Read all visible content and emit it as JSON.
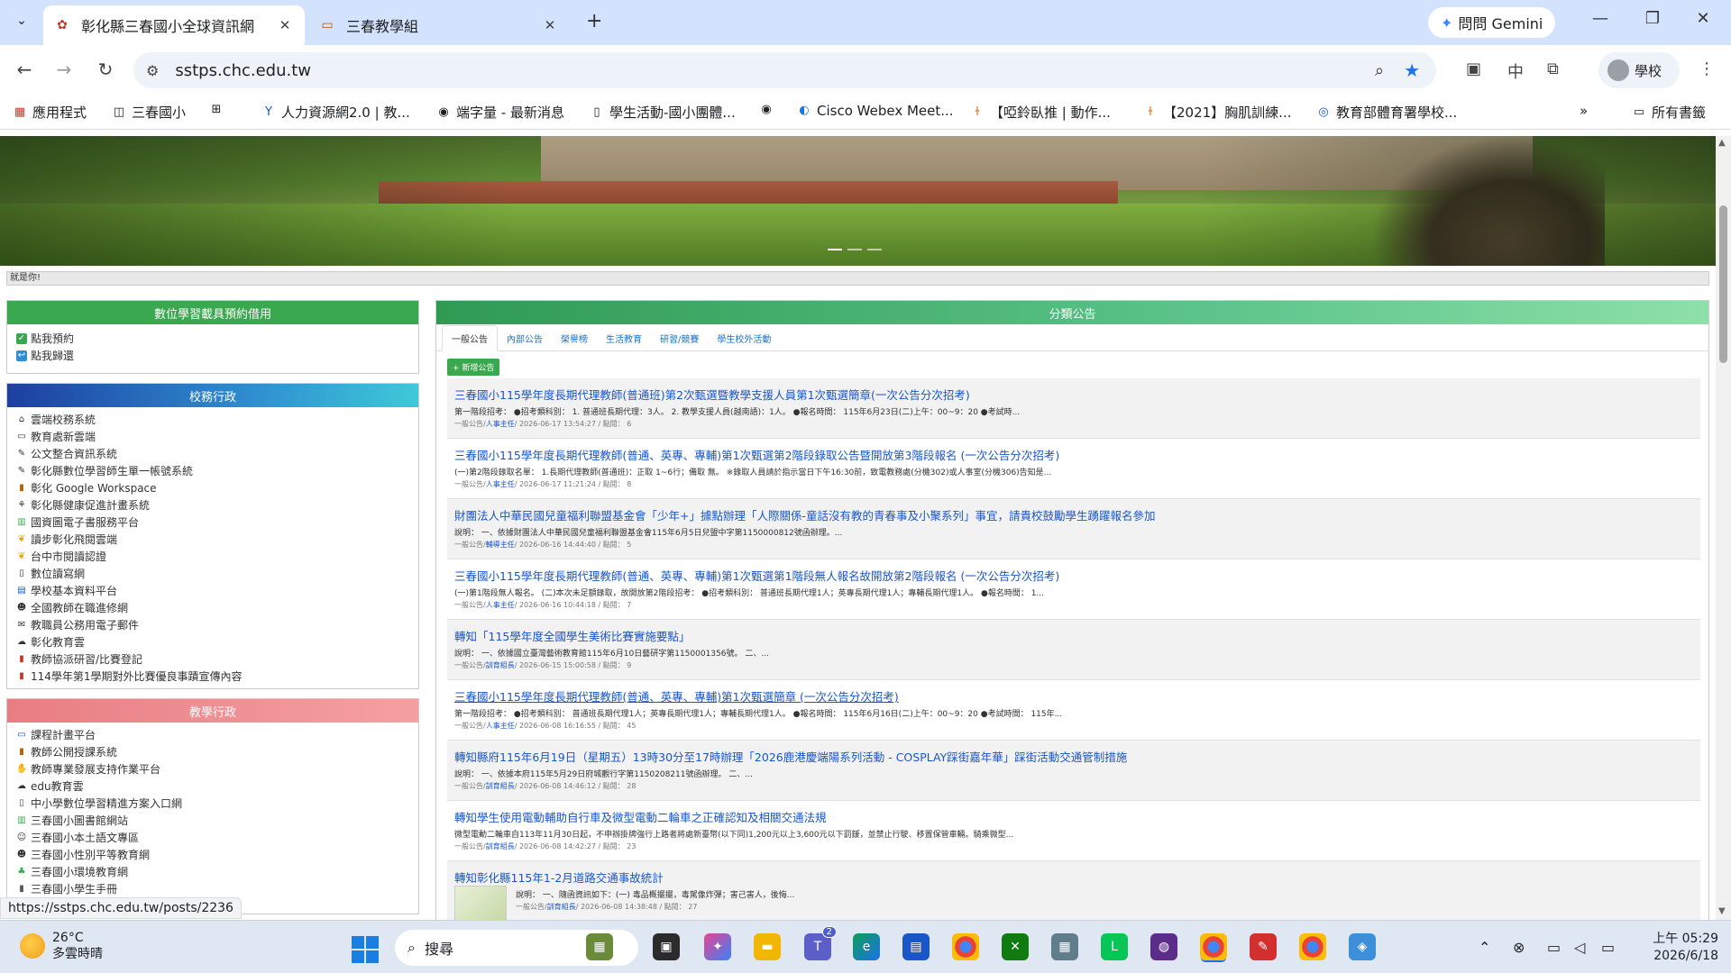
{
  "browser": {
    "tabs": [
      {
        "title": "彰化縣三春國小全球資訊網",
        "active": true
      },
      {
        "title": "三春教學組",
        "active": false
      }
    ],
    "gemini_label": "問問 Gemini",
    "url": "sstps.chc.edu.tw",
    "ime_indicator": "中",
    "profile_label": "學校",
    "bookmarks": [
      "應用程式",
      "三春國小",
      "人力資源網2.0 | 教...",
      "端字量 - 最新消息",
      "學生活動-國小團體...",
      "Cisco Webex Meet...",
      "【啞鈴臥推 | 動作...",
      "【2021】胸肌訓練...",
      "教育部體育署學校..."
    ],
    "all_bookmarks_label": "所有書籤",
    "status_url": "https://sstps.chc.edu.tw/posts/2236"
  },
  "page": {
    "marquee_text": "就是你!",
    "left_panels": [
      {
        "title": "數位學習載具預約借用",
        "items": [
          "點我預約",
          "點我歸還"
        ]
      },
      {
        "title": "校務行政",
        "items": [
          "雲端校務系統",
          "教育處新雲端",
          "公文整合資訊系統",
          "彰化縣數位學習師生單一帳號系統",
          "彰化 Google Workspace",
          "彰化縣健康促進計畫系統",
          "國資圖電子書服務平台",
          "讀步彰化飛閱雲端",
          "台中市閱讀認證",
          "數位讀寫網",
          "學校基本資料平台",
          "全國教師在職進修網",
          "教職員公務用電子郵件",
          "彰化教育雲",
          "教師協派研習/比賽登記",
          "114學年第1學期對外比賽優良事蹟宣傳內容"
        ]
      },
      {
        "title": "教學行政",
        "items": [
          "課程計畫平台",
          "教師公開授課系統",
          "教師專業發展支持作業平台",
          "edu教育雲",
          "中小學數位學習精進方案入口網",
          "三春國小圖書館網站",
          "三春國小本土語文專區",
          "三春國小性別平等教育網",
          "三春國小環境教育網",
          "三春國小學生手冊"
        ]
      }
    ],
    "announcements": {
      "title": "分類公告",
      "tabs": [
        "一般公告",
        "內部公告",
        "榮譽榜",
        "生活教育",
        "研習/競賽",
        "學生校外活動"
      ],
      "new_button": "+ 新增公告",
      "posts": [
        {
          "title": "三春國小115學年度長期代理教師(普通班)第2次甄選暨教學支援人員第1次甄選簡章(一次公告分次招考)",
          "summary": "第一階段招考： ●招考類科別： 1. 普通班長期代理：3人。 2. 教學支援人員(越南語)：1人。 ●報名時間： 115年6月23日(二)上午：00~9：20 ●考試時...",
          "meta": "一般公告/",
          "author": "人事主任",
          "info": "/ 2026-06-17 13:54:27 / 點閱： 6"
        },
        {
          "title": "三春國小115學年度長期代理教師(普通、英專、專輔)第1次甄選第2階段錄取公告暨開放第3階段報名 (一次公告分次招考)",
          "summary": "(一)第2階段錄取名單： 1.長期代理教師(普通班)：正取 1~6行；備取 無。 ※錄取人員請於指示當日下午16:30前，致電教務處(分機302)或人事室(分機306)告知是...",
          "meta": "一般公告/",
          "author": "人事主任",
          "info": "/ 2026-06-17 11:21:24 / 點閱： 8"
        },
        {
          "title": "財團法人中華民國兒童福利聯盟基金會「少年+」據點辦理「人際關係-童話沒有教的青春事及小聚系列」事宜，請貴校鼓勵學生踴躍報名參加",
          "summary": "說明： 一、依據財團法人中華民國兒童福利聯盟基金會115年6月5日兒盟中字第1150000812號函辦理。...",
          "meta": "一般公告/",
          "author": "輔導主任",
          "info": "/ 2026-06-16 14:44:40 / 點閱： 5"
        },
        {
          "title": "三春國小115學年度長期代理教師(普通、英專、專輔)第1次甄選第1階段無人報名故開放第2階段報名 (一次公告分次招考)",
          "summary": "(一)第1階段無人報名。 (二)本次未足額錄取，故開放第2階段招考： ●招考類科別： 普通班長期代理1人；英專長期代理1人；專輔長期代理1人。 ●報名時間： 1...",
          "meta": "一般公告/",
          "author": "人事主任",
          "info": "/ 2026-06-16 10:44:18 / 點閱： 7"
        },
        {
          "title": "轉知「115學年度全國學生美術比賽實施要點」",
          "summary": "說明： 一、依據國立臺灣藝術教育館115年6月10日藝研字第1150001356號。 二、...",
          "meta": "一般公告/",
          "author": "訓育組長",
          "info": "/ 2026-06-15 15:00:58 / 點閱： 9"
        },
        {
          "title": "三春國小115學年度長期代理教師(普通、英專、專輔)第1次甄選簡章 (一次公告分次招考)",
          "summary": "第一階段招考： ●招考類科別： 普通班長期代理1人；英專長期代理1人；專輔長期代理1人。 ●報名時間： 115年6月16日(二)上午：00~9：20 ●考試時間： 115年...",
          "meta": "一般公告/",
          "author": "人事主任",
          "info": "/ 2026-06-08 16:16:55 / 點閱： 45"
        },
        {
          "title": "轉知縣府115年6月19日（星期五）13時30分至17時辦理「2026鹿港慶端陽系列活動 - COSPLAY踩街嘉年華」踩街活動交通管制措施",
          "summary": "說明： 一、依據本府115年5月29日府城觀行字第1150208211號函辦理。 二、...",
          "meta": "一般公告/",
          "author": "訓育組長",
          "info": "/ 2026-06-08 14:46:12 / 點閱： 28"
        },
        {
          "title": "轉知學生使用電動輔助自行車及微型電動二輪車之正確認知及相關交通法規",
          "summary": "微型電動二輪車自113年11月30日起，不申辦掛牌強行上路者將處新臺幣(以下同)1,200元以上3,600元以下罰鍰，並禁止行駛、移置保管車輛。騎乘微型...",
          "meta": "一般公告/",
          "author": "訓育組長",
          "info": "/ 2026-06-08 14:42:27 / 點閱： 23"
        },
        {
          "title": "轉知彰化縣115年1-2月道路交通事故統計",
          "summary": "說明： 一、隨函資訊如下：(一) 毒品概擺擺，毒駕像炸彈；害己害人，後悔...",
          "meta": "一般公告/",
          "author": "訓育組長",
          "info": "/ 2026-06-08 14:38:48 / 點閱： 27"
        }
      ]
    }
  },
  "taskbar": {
    "temperature": "26°C",
    "weather_desc": "多雲時晴",
    "search_placeholder": "搜尋",
    "notification_badge_teams": "2",
    "time": "上午 05:29",
    "date": "2026/6/18"
  },
  "colors": {
    "tabbar_bg": "#d3e3fd",
    "link_blue": "#1a56c8",
    "panel_green": "#3aa84f",
    "panel_pink": "#e87e83",
    "taskbar_bg": "#dfe7f3"
  }
}
